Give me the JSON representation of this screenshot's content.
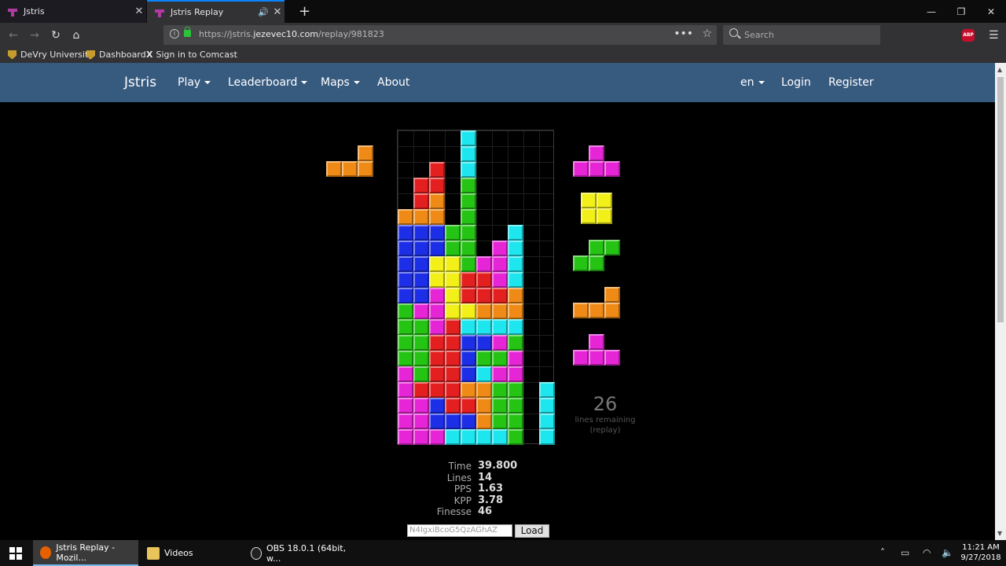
{
  "browser": {
    "tabs": [
      {
        "title": "Jstris"
      },
      {
        "title": "Jstris Replay"
      }
    ],
    "url_prefix": "https://jstris.",
    "url_domain": "jezevec10.com",
    "url_path": "/replay/981823",
    "search_placeholder": "Search",
    "adblock_label": "ABP",
    "bookmarks": [
      {
        "label": "DeVry University"
      },
      {
        "label": "Dashboard"
      },
      {
        "label": "Sign in to Comcast"
      }
    ]
  },
  "site_nav": {
    "brand": "Jstris",
    "items": [
      {
        "label": "Play"
      },
      {
        "label": "Leaderboard"
      },
      {
        "label": "Maps"
      },
      {
        "label": "About"
      }
    ],
    "lang": "en",
    "login": "Login",
    "register": "Register"
  },
  "colors": {
    "orange": "#f08a16",
    "red": "#e3201f",
    "blue": "#1d2fe6",
    "green": "#25c314",
    "cyan": "#1ee6ee",
    "magenta": "#e625d6",
    "yellow": "#f2ef19",
    "ghost": "#0e6c70"
  },
  "game": {
    "board_rows": [
      "....C.....",
      "....C.....",
      "..R.C.....",
      ".RR.G.....",
      ".RO.G.....",
      "OOO.G.....",
      "BBBGG..C..",
      "BBBGG.MC..",
      "BBYYGMMC..",
      "BBYYRRMC..",
      "BBMYRRRO..",
      "GMMYYOOO..",
      "GGMRCCCC..",
      "GGRRBBMG..",
      "GGRRBGGM..",
      "MGRRBCMM..",
      "MRRROOGG.C",
      "MMBRROGG.C",
      "MMBBBOGG.C",
      "MMMCCCCG.C"
    ],
    "hold": [
      "..O",
      "OOO"
    ],
    "queue": [
      [
        ".M.",
        "MMM"
      ],
      [
        "YY",
        "YY"
      ],
      [
        ".GG",
        "GG."
      ],
      [
        "..O",
        "OOO"
      ],
      [
        ".M.",
        "MMM"
      ]
    ],
    "lines_remaining": "26",
    "lines_remaining_label": "lines remaining",
    "lines_remaining_sub": "(replay)",
    "stats": [
      {
        "key": "Time",
        "value": "39.800"
      },
      {
        "key": "Lines",
        "value": "14"
      },
      {
        "key": "PPS",
        "value": "1.63"
      },
      {
        "key": "KPP",
        "value": "3.78"
      },
      {
        "key": "Finesse",
        "value": "46"
      }
    ],
    "replay_code": "N4IgxiBcoG5QzAGhAZ",
    "load_label": "Load"
  },
  "taskbar": {
    "tasks": [
      {
        "label": "Jstris Replay - Mozil..."
      },
      {
        "label": "Videos"
      },
      {
        "label": "OBS 18.0.1 (64bit, w..."
      }
    ],
    "time": "11:21 AM",
    "date": "9/27/2018"
  }
}
